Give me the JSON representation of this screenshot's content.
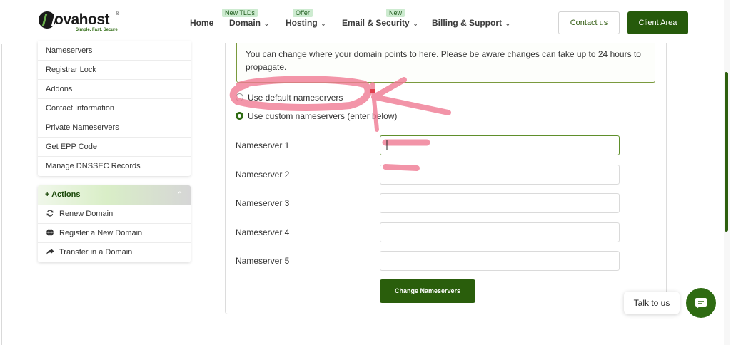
{
  "brand": {
    "name": "ovahost",
    "registered": "®",
    "tagline": "Simple. Fast. Secure",
    "accent": "#265a0b"
  },
  "nav": {
    "home": "Home",
    "domain": "Domain",
    "domain_badge": "New TLDs",
    "hosting": "Hosting",
    "hosting_badge": "Offer",
    "email": "Email & Security",
    "email_badge": "New",
    "billing": "Billing & Support",
    "contact": "Contact us",
    "client_area": "Client Area"
  },
  "sidebar": {
    "items": [
      {
        "label": "Nameservers"
      },
      {
        "label": "Registrar Lock"
      },
      {
        "label": "Addons"
      },
      {
        "label": "Contact Information"
      },
      {
        "label": "Private Nameservers"
      },
      {
        "label": "Get EPP Code"
      },
      {
        "label": "Manage DNSSEC Records"
      }
    ],
    "actions_prefix": "+",
    "actions_title": "Actions",
    "actions": [
      {
        "label": "Renew Domain",
        "icon": "refresh-icon"
      },
      {
        "label": "Register a New Domain",
        "icon": "globe-icon"
      },
      {
        "label": "Transfer in a Domain",
        "icon": "share-arrow-icon"
      }
    ]
  },
  "main": {
    "alert_text": "You can change where your domain points to here. Please be aware changes can take up to 24 hours to propagate.",
    "option_default": "Use default nameservers",
    "option_custom": "Use custom nameservers (enter below)",
    "selected_option": "custom",
    "nameservers": [
      {
        "label": "Nameserver 1",
        "value": ""
      },
      {
        "label": "Nameserver 2",
        "value": ""
      },
      {
        "label": "Nameserver 3",
        "value": ""
      },
      {
        "label": "Nameserver 4",
        "value": ""
      },
      {
        "label": "Nameserver 5",
        "value": ""
      }
    ],
    "submit_label": "Change Nameservers"
  },
  "chat": {
    "label": "Talk to us"
  },
  "annotation_color": "#f07a93"
}
